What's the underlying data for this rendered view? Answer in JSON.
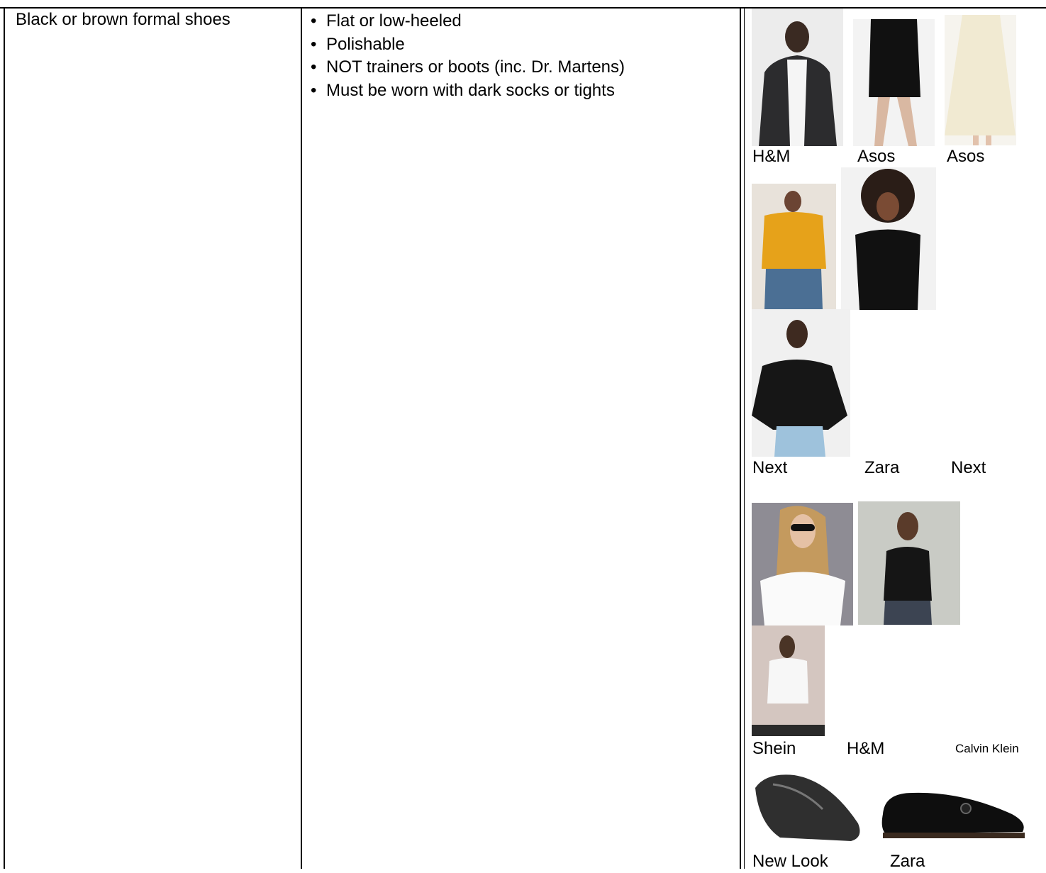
{
  "row": {
    "item_name": "Black or brown formal shoes",
    "requirements": [
      "Flat or low-heeled",
      "Polishable",
      "NOT trainers or boots (inc. Dr. Martens)",
      "Must be worn with dark socks or tights"
    ]
  },
  "examples": {
    "group1_labels": [
      "H&M",
      "Asos",
      "Asos"
    ],
    "group2_labels": [
      "Next",
      "Zara",
      "Next"
    ],
    "group3_labels": [
      "Shein",
      "H&M",
      "Calvin Klein"
    ],
    "group4_labels": [
      "New Look",
      "Zara"
    ]
  }
}
